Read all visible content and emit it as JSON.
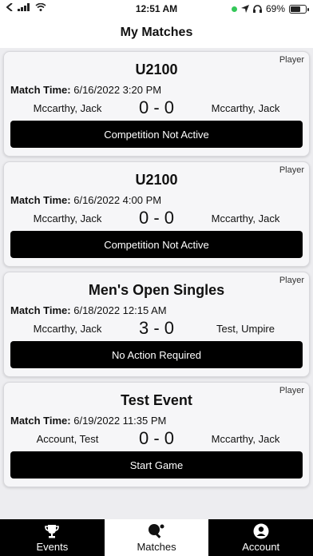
{
  "status": {
    "time": "12:51 AM",
    "battery": "69%",
    "battery_level": 0.69
  },
  "header": {
    "title": "My Matches"
  },
  "matches": [
    {
      "role": "Player",
      "event": "U2100",
      "time_label": "Match Time:",
      "time": "6/16/2022 3:20 PM",
      "player1": "Mccarthy, Jack",
      "score": "0 - 0",
      "player2": "Mccarthy, Jack",
      "action": "Competition Not Active"
    },
    {
      "role": "Player",
      "event": "U2100",
      "time_label": "Match Time:",
      "time": "6/16/2022 4:00 PM",
      "player1": "Mccarthy, Jack",
      "score": "0 - 0",
      "player2": "Mccarthy, Jack",
      "action": "Competition Not Active"
    },
    {
      "role": "Player",
      "event": "Men's Open Singles",
      "time_label": "Match Time:",
      "time": "6/18/2022 12:15 AM",
      "player1": "Mccarthy, Jack",
      "score": "3 - 0",
      "player2": "Test, Umpire",
      "action": "No Action Required"
    },
    {
      "role": "Player",
      "event": "Test Event",
      "time_label": "Match Time:",
      "time": "6/19/2022 11:35 PM",
      "player1": "Account, Test",
      "score": "0 - 0",
      "player2": "Mccarthy, Jack",
      "action": "Start Game"
    }
  ],
  "tabs": [
    {
      "label": "Events",
      "icon": "trophy-icon"
    },
    {
      "label": "Matches",
      "icon": "table-tennis-icon"
    },
    {
      "label": "Account",
      "icon": "account-icon"
    }
  ]
}
